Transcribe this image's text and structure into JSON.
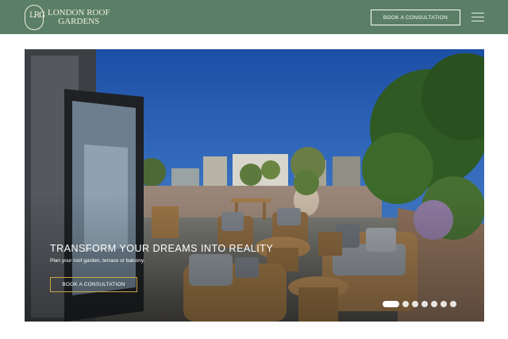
{
  "header": {
    "logo_monogram": "LRG",
    "brand_line1": "London Roof",
    "brand_line2": "Gardens",
    "cta_label": "Book a Consultation",
    "menu_icon": "hamburger-icon"
  },
  "hero": {
    "title": "Transform your dreams into reality",
    "subtitle": "Plan your roof garden, terrace or balcony.",
    "cta_label": "Book a Consultation",
    "slides_total": 7,
    "active_slide": 1
  },
  "colors": {
    "header_bg": "#5a7f66",
    "accent_gold": "#c9a64a"
  }
}
